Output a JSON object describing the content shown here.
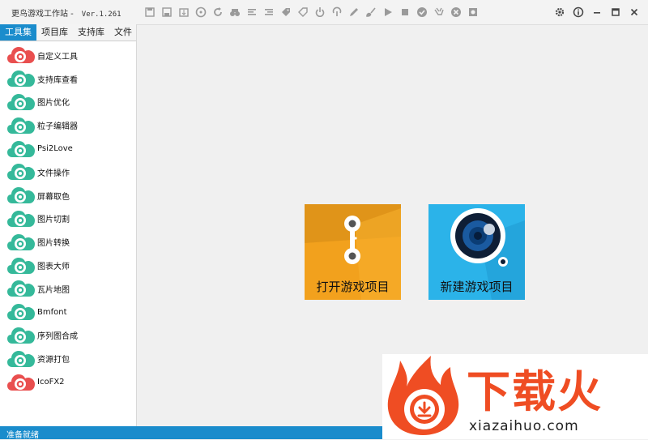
{
  "window": {
    "title": "更鸟游戏工作站 -",
    "version": "Ver.1.261"
  },
  "toolbar": {
    "icons": [
      "save-icon",
      "save-as-icon",
      "export-icon",
      "steering-icon",
      "refresh-icon",
      "binoculars-icon",
      "align-icon",
      "align-right-icon",
      "tag-icon",
      "tag-edit-icon",
      "power-icon",
      "restart-icon",
      "pencil-icon",
      "brush-icon",
      "play-icon",
      "stop-icon",
      "check-icon",
      "clean-icon",
      "close-circle-icon",
      "settings-box-icon"
    ]
  },
  "window_controls": [
    "gear-icon",
    "info-icon",
    "minimize-icon",
    "maximize-icon",
    "close-icon"
  ],
  "tabs": [
    {
      "label": "工具集",
      "active": true
    },
    {
      "label": "项目库",
      "active": false
    },
    {
      "label": "支持库",
      "active": false
    },
    {
      "label": "文件",
      "active": false
    }
  ],
  "tools": [
    {
      "label": "自定义工具",
      "color": "#e94f4f"
    },
    {
      "label": "支持库查看",
      "color": "#35b99a"
    },
    {
      "label": "图片优化",
      "color": "#35b99a"
    },
    {
      "label": "粒子编辑器",
      "color": "#35b99a"
    },
    {
      "label": "Psi2Love",
      "color": "#35b99a"
    },
    {
      "label": "文件操作",
      "color": "#35b99a"
    },
    {
      "label": "屏幕取色",
      "color": "#35b99a"
    },
    {
      "label": "图片切割",
      "color": "#35b99a"
    },
    {
      "label": "图片转换",
      "color": "#35b99a"
    },
    {
      "label": "图表大师",
      "color": "#35b99a"
    },
    {
      "label": "瓦片地图",
      "color": "#35b99a"
    },
    {
      "label": "Bmfont",
      "color": "#35b99a"
    },
    {
      "label": "序列图合成",
      "color": "#35b99a"
    },
    {
      "label": "资源打包",
      "color": "#35b99a"
    },
    {
      "label": "IcoFX2",
      "color": "#e94f4f"
    }
  ],
  "main": {
    "open_project": "打开游戏项目",
    "new_project": "新建游戏项目"
  },
  "watermark": {
    "text": "下载火",
    "url": "xiazaihuo.com"
  },
  "status": {
    "text": "准备就绪"
  }
}
